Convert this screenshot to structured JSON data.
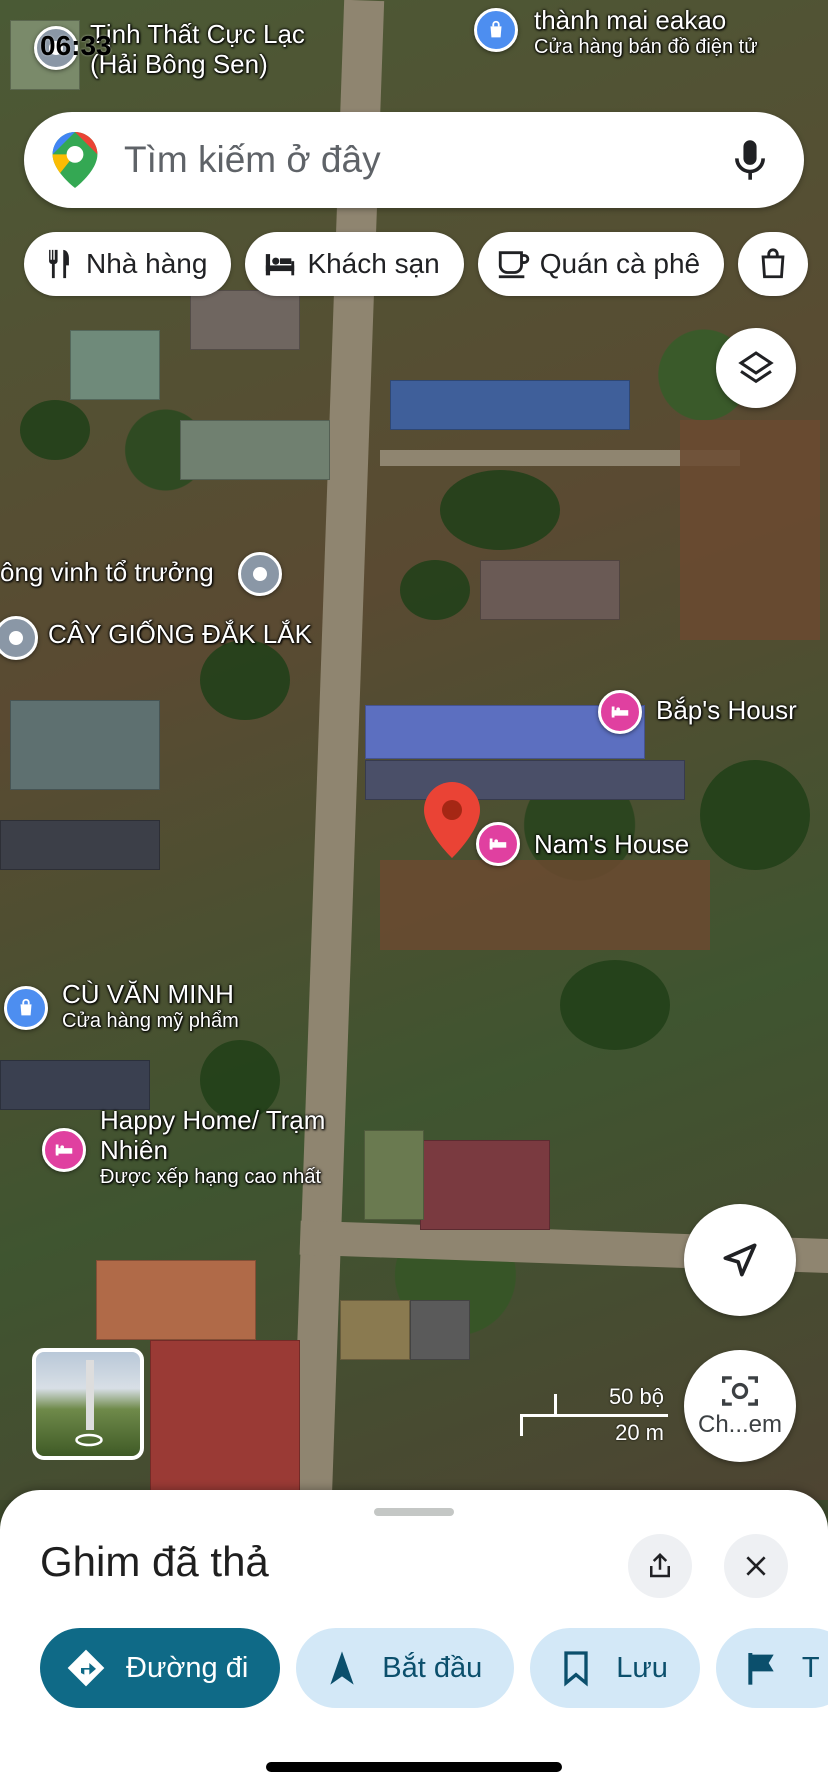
{
  "status_bar": {
    "time": "06:33"
  },
  "search": {
    "placeholder": "Tìm kiếm ở đây",
    "logo_icon": "google-maps-pin-icon",
    "mic_icon": "microphone-icon"
  },
  "chips": [
    {
      "label": "Nhà hàng",
      "icon": "restaurant-icon"
    },
    {
      "label": "Khách sạn",
      "icon": "hotel-bed-icon"
    },
    {
      "label": "Quán cà phê",
      "icon": "coffee-cup-icon"
    },
    {
      "label": "",
      "icon": "shopping-bag-icon"
    }
  ],
  "map": {
    "places": [
      {
        "name": "Tịnh Thất Cực Lạc",
        "sub": "(Hải Bông Sen)"
      },
      {
        "name": "thành mai eakao",
        "sub": "Cửa hàng bán đồ điện tử"
      },
      {
        "name": "ông vinh tổ trưởng",
        "sub": ""
      },
      {
        "name": "CÂY GIỐNG ĐẮK LẮK",
        "sub": ""
      },
      {
        "name": "Bắp's Housr",
        "sub": ""
      },
      {
        "name": "Nam's House",
        "sub": ""
      },
      {
        "name": "CÙ VĂN MINH",
        "sub": "Cửa hàng mỹ phẩm"
      },
      {
        "name": "Happy Home/ Trạm Nhiên",
        "sub": "Được xếp hạng cao nhất"
      }
    ],
    "scale": {
      "imperial": "50 bộ",
      "metric": "20 m"
    },
    "lens_label": "Ch...em",
    "dropped_pin_color": "#ea4335"
  },
  "sheet": {
    "title": "Ghim đã thả",
    "share_icon": "share-icon",
    "close_icon": "close-icon",
    "actions": [
      {
        "label": "Đường đi",
        "icon": "directions-icon",
        "primary": true
      },
      {
        "label": "Bắt đầu",
        "icon": "navigation-arrow-icon",
        "primary": false
      },
      {
        "label": "Lưu",
        "icon": "bookmark-icon",
        "primary": false
      },
      {
        "label": "T",
        "icon": "flag-icon",
        "primary": false
      }
    ]
  },
  "colors": {
    "primary_action": "#0f6a87",
    "secondary_action": "#d3e8f7",
    "hotel_pin": "#e040a0",
    "shop_pin": "#4d8ef0"
  }
}
